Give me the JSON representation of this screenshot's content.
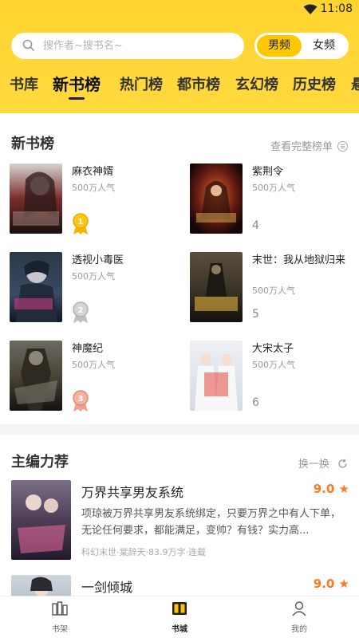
{
  "status": {
    "time": "11:08"
  },
  "search": {
    "placeholder": "搜作者~搜书名~"
  },
  "gender": {
    "male": "男频",
    "female": "女频"
  },
  "categories": [
    "书库",
    "新书榜",
    "热门榜",
    "都市榜",
    "玄幻榜",
    "历史榜",
    "悬"
  ],
  "newbooks": {
    "title": "新书榜",
    "more": "查看完整榜单",
    "items": [
      {
        "title": "麻衣神婿",
        "pop": "500万人气",
        "rank": "1"
      },
      {
        "title": "透视小毒医",
        "pop": "500万人气",
        "rank": "2"
      },
      {
        "title": "神魔纪",
        "pop": "500万人气",
        "rank": "3"
      },
      {
        "title": "紫荆令",
        "pop": "500万人气",
        "rank": "4"
      },
      {
        "title": "末世：我从地狱归来",
        "pop": "500万人气",
        "rank": "5"
      },
      {
        "title": "大宋太子",
        "pop": "500万人气",
        "rank": "6"
      }
    ]
  },
  "editor": {
    "title": "主编力荐",
    "more": "换一换",
    "items": [
      {
        "title": "万界共享男友系统",
        "score": "9.0",
        "desc": "项琼被万界共享男友系统绑定，只要万界之中有人下单，无论任何要求，都能满足，变帅？有钱？实力高...",
        "meta": "科幻末世·棠辞天·83.9万字·连载"
      },
      {
        "title": "一剑倾城",
        "score": "9.0"
      }
    ]
  },
  "tabs": {
    "shelf": "书架",
    "store": "书城",
    "mine": "我的"
  },
  "colors": {
    "accent": "#ffc700",
    "score": "#ff7a1f"
  }
}
